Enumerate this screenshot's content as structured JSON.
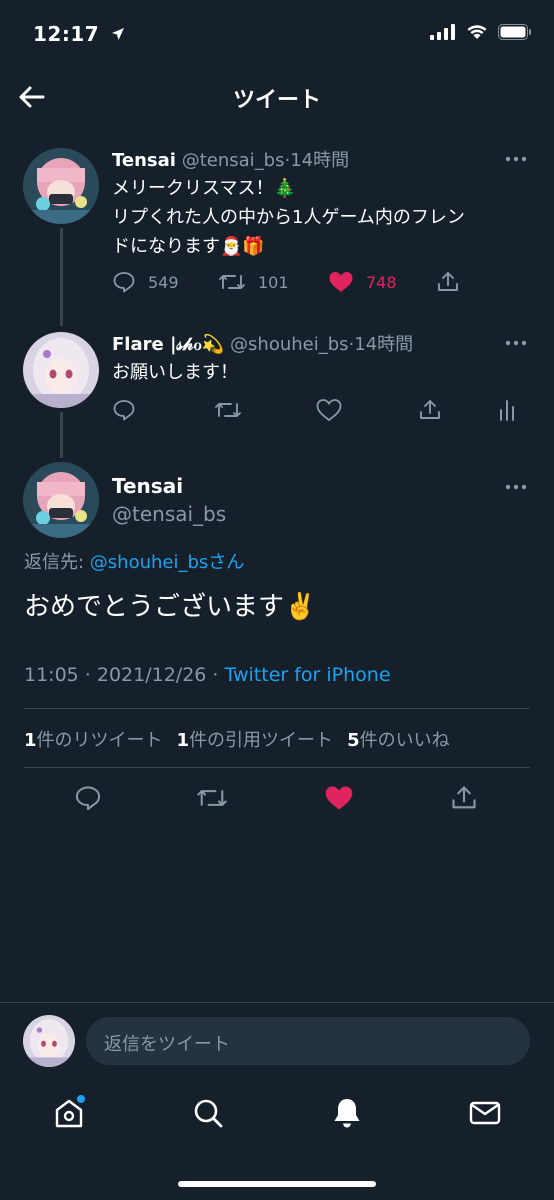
{
  "status": {
    "time": "12:17"
  },
  "nav": {
    "title": "ツイート"
  },
  "tweet1": {
    "name": "Tensai",
    "handle": "@tensai_bs",
    "time": "14時間",
    "line1": "メリークリスマス！🎄",
    "line2": "リプくれた人の中から1人ゲーム内のフレン",
    "line3": "ドになります🎅🎁",
    "replies": "549",
    "retweets": "101",
    "likes": "748"
  },
  "tweet2": {
    "name": "Flare |𝓈𝒽ℴ💫",
    "handle": "@shouhei_bs",
    "time": "14時間",
    "text": "お願いします！"
  },
  "main": {
    "name": "Tensai",
    "handle": "@tensai_bs",
    "reply_prefix": "返信先: ",
    "reply_user": "@shouhei_bs",
    "reply_suffix": "さん",
    "text": "おめでとうございます✌️",
    "timestamp": "11:05 · 2021/12/26 · ",
    "source": "Twitter for iPhone",
    "rt_count": "1",
    "rt_label": "件のリツイート",
    "quote_count": "1",
    "quote_label": "件の引用ツイート",
    "like_count": "5",
    "like_label": "件のいいね"
  },
  "reply": {
    "placeholder": "返信をツイート"
  },
  "colors": {
    "background": "#15202b",
    "accent": "#1da1f2",
    "like": "#e0245e",
    "muted": "#8899a6",
    "divider": "#38444d"
  },
  "icons": [
    "back-arrow-icon",
    "reply-icon",
    "retweet-icon",
    "like-icon",
    "share-icon",
    "analytics-icon",
    "more-icon",
    "home-icon",
    "search-icon",
    "notifications-icon",
    "messages-icon"
  ]
}
